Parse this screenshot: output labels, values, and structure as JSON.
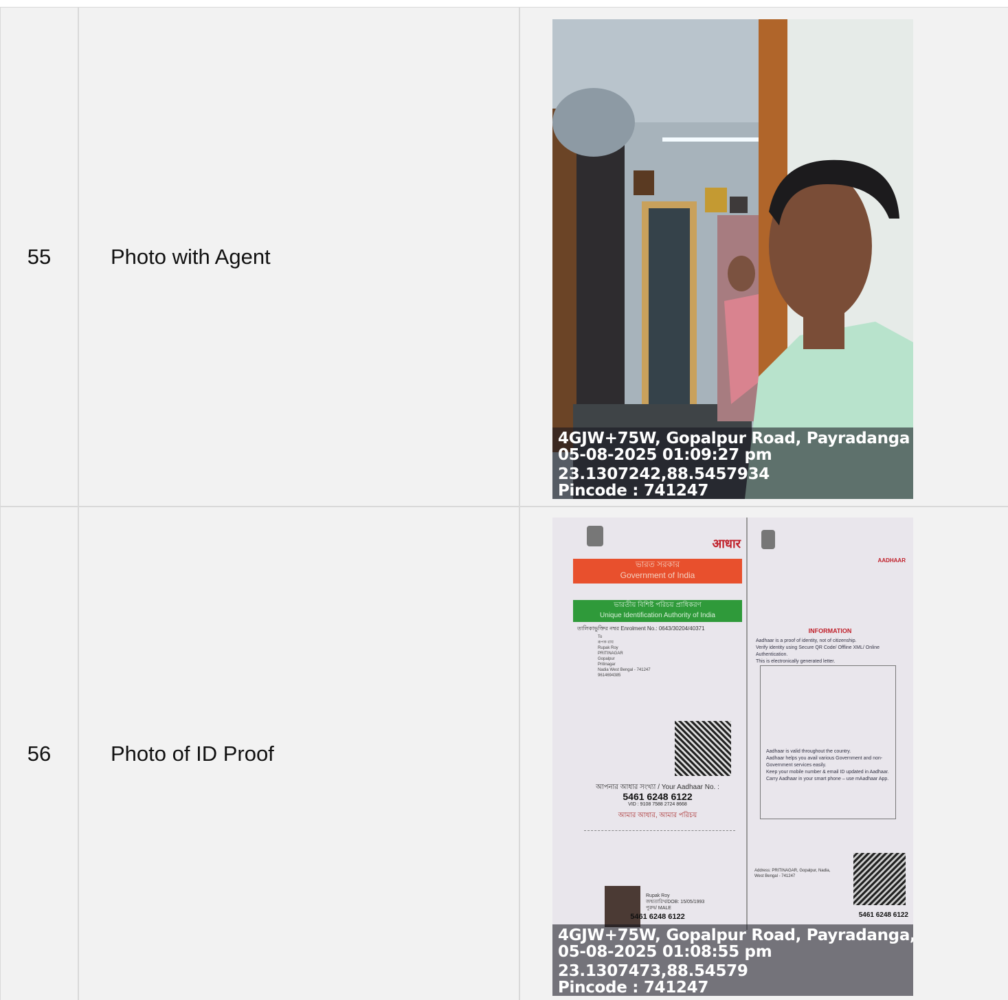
{
  "rows": [
    {
      "number": "55",
      "label": "Photo with Agent",
      "photo": {
        "subject": "selfie-in-doorway",
        "geotag": {
          "address": "4GJW+75W, Gopalpur Road, Payradanga",
          "datetime": "05-08-2025 01:09:27 pm",
          "coords": "23.1307242,88.5457934",
          "pincode": "Pincode : 741247"
        }
      }
    },
    {
      "number": "56",
      "label": "Photo of ID Proof",
      "photo": {
        "subject": "aadhaar-letter",
        "document": {
          "gov_bn": "ভারত সরকার",
          "gov_en": "Government of India",
          "uidai_bn": "ভারতীয় বিশিষ্ট পরিচয় প্রাধিকরণ",
          "uidai_en": "Unique Identification Authority of India",
          "enrolment": "তালিকাভুক্তির নম্বর Enrolment No.: 0643/30204/40371",
          "address_lines": [
            "To",
            "রূপক রায়",
            "Rupak Roy",
            "PRITINAGAR",
            "Gopalpur",
            "Pritinagar",
            "Nadia West Bengal - 741247",
            "9614694385"
          ],
          "your_aadhaar": "আপনার আধার সংখ্যা / Your Aadhaar No. :",
          "number": "5461 6248 6122",
          "vid": "VID : 9108 7588 2724 8668",
          "tagline": "আমার আধার, আমার পরিচয়",
          "info_title": "INFORMATION",
          "info_lines": [
            "Aadhaar is a proof of identity, not of citizenship.",
            "Verify identity using Secure QR Code/ Offline XML/ Online Authentication.",
            "This is electronically generated letter."
          ],
          "box_lines": [
            "Aadhaar is valid throughout the country.",
            "Aadhaar helps you avail various Government and non-Government services easily.",
            "Keep your mobile number & email ID updated in Aadhaar.",
            "Carry Aadhaar in your smart phone – use mAadhaar App."
          ],
          "card_name": "Rupak Roy",
          "card_dob": "জন্মতারিখ/DOB: 15/05/1993",
          "card_gender": "পুরুষ/ MALE",
          "card_number": "5461 6248 6122",
          "card_back_number": "5461 6248 6122",
          "card_back_address": "Address: PRITINAGAR, Gopalpur, Nadia, West Bengal - 741247",
          "aadhaar_logo": "आधार",
          "aadhaar_logo2": "AADHAAR"
        },
        "geotag": {
          "address": "4GJW+75W, Gopalpur Road, Payradanga,",
          "datetime": "05-08-2025 01:08:55 pm",
          "coords": "23.1307473,88.54579",
          "pincode": "Pincode : 741247"
        }
      }
    }
  ]
}
